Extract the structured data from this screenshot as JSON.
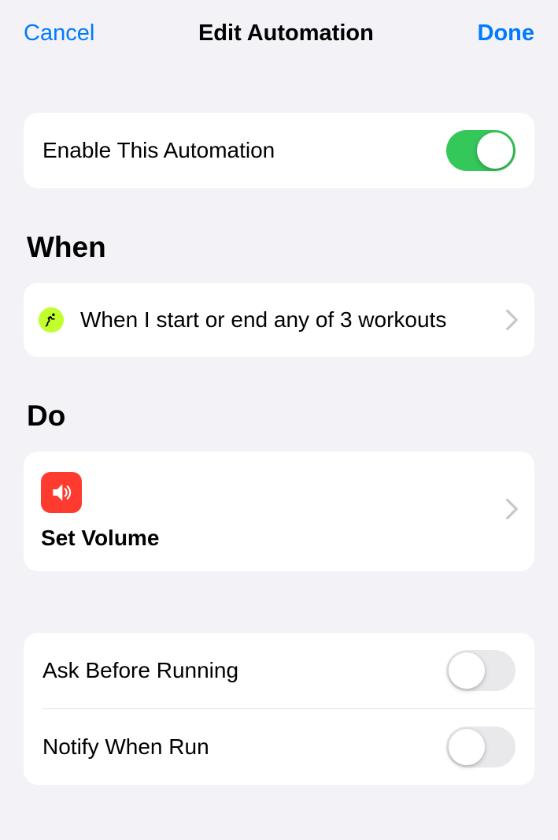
{
  "header": {
    "cancel": "Cancel",
    "title": "Edit Automation",
    "done": "Done"
  },
  "enable": {
    "label": "Enable This Automation",
    "on": true
  },
  "sections": {
    "when": "When",
    "do": "Do"
  },
  "trigger": {
    "icon": "running-icon",
    "text": "When I start or end any of 3 workouts"
  },
  "action": {
    "icon": "speaker-icon",
    "title": "Set Volume"
  },
  "options": {
    "askBefore": {
      "label": "Ask Before Running",
      "on": false
    },
    "notify": {
      "label": "Notify When Run",
      "on": false
    }
  }
}
